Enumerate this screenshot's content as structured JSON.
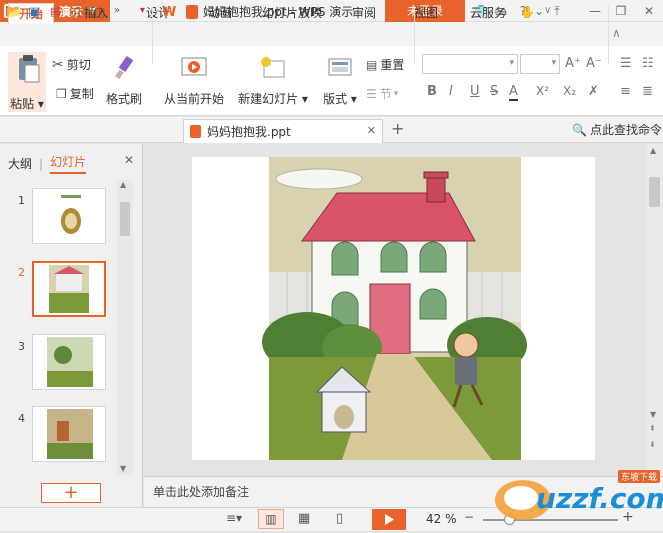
{
  "titlebar": {
    "app_label": "WPS 演示",
    "doc_title": "妈妈抱抱我.ppt - WPS 演示",
    "login_label": "未登录"
  },
  "menu": {
    "tabs": [
      "开始",
      "插入",
      "设计",
      "动画",
      "幻灯片放映",
      "审阅",
      "视图",
      "云服务"
    ]
  },
  "ribbon": {
    "paste": "粘贴",
    "cut": "剪切",
    "copy": "复制",
    "format_painter": "格式刷",
    "from_current": "从当前开始",
    "new_slide": "新建幻灯片",
    "layout": "版式",
    "reset": "重置",
    "section": "节",
    "format_buttons": [
      "B",
      "I",
      "U",
      "S",
      "A",
      "X²",
      "X₂",
      "✗"
    ]
  },
  "quickbar": {
    "doc_tab": "妈妈抱抱我.ppt",
    "search_label": "点此查找命令"
  },
  "leftpane": {
    "tab_outline": "大纲",
    "tab_slides": "幻灯片",
    "slide_numbers": [
      "1",
      "2",
      "3",
      "4"
    ],
    "add_label": "+"
  },
  "notes": {
    "placeholder": "单击此处添加备注"
  },
  "statusbar": {
    "zoom": "42 %"
  },
  "watermark": {
    "text": "uzzf.com",
    "tag": "东坡下载"
  },
  "colors": {
    "accent": "#e8632b",
    "sky": "#d9d2b0",
    "grass": "#7d9a3a",
    "roof": "#d9536a"
  }
}
